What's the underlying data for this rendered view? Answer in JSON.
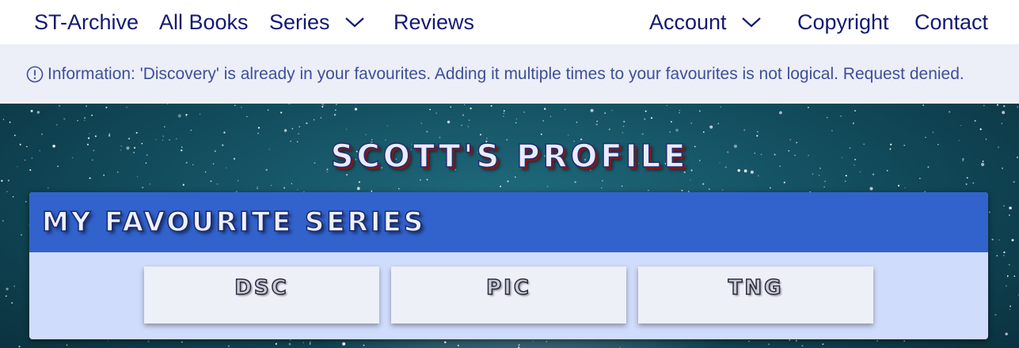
{
  "nav": {
    "brand": "ST-Archive",
    "all_books": "All Books",
    "series": "Series",
    "reviews": "Reviews",
    "account": "Account",
    "copyright": "Copyright",
    "contact": "Contact"
  },
  "banner": {
    "icon": "info-circle-icon",
    "text": "Information: 'Discovery' is already in your favourites. Adding it multiple times to your favourites is not logical. Request denied."
  },
  "profile": {
    "title": "Scott's Profile"
  },
  "favourites": {
    "heading": "My Favourite Series",
    "series": [
      {
        "label": "DSC"
      },
      {
        "label": "PIC"
      },
      {
        "label": "TNG"
      }
    ]
  },
  "colors": {
    "nav_text": "#141a73",
    "banner_bg": "#eceff8",
    "banner_text": "#3f4f99",
    "card_header": "#3263cc",
    "card_body": "#cfdcfb",
    "tile_bg": "#eef0f8"
  }
}
